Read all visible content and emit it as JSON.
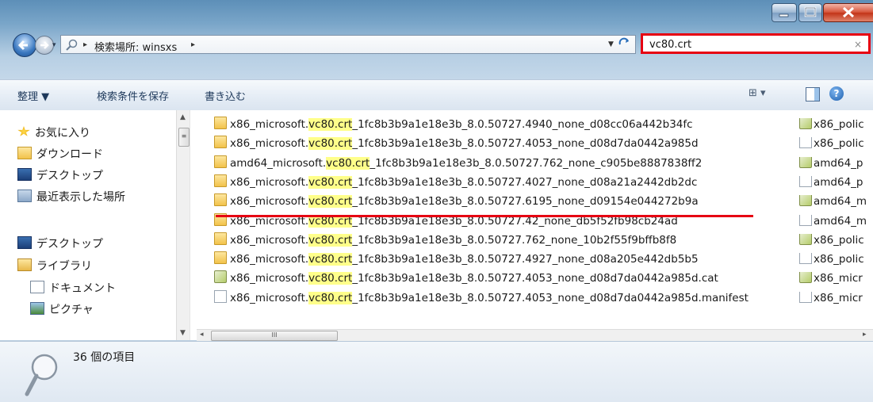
{
  "window": {
    "address": {
      "recent_dropdown": "▾",
      "separator1": "▸",
      "label": "検索場所: winsxs",
      "separator2": "▸"
    },
    "search": {
      "value": "vc80.crt",
      "clear": "×"
    }
  },
  "toolbar": {
    "organize": "整理 ▼",
    "save_search": "検索条件を保存",
    "burn": "書き込む",
    "views": "⊞ ▾",
    "help": "?"
  },
  "sidebar": {
    "items": [
      {
        "label": "お気に入り",
        "icon": "star-icon"
      },
      {
        "label": "ダウンロード",
        "icon": "download-folder-icon"
      },
      {
        "label": "デスクトップ",
        "icon": "desktop-icon"
      },
      {
        "label": "最近表示した場所",
        "icon": "recent-places-icon"
      },
      {
        "label": "デスクトップ",
        "icon": "desktop-icon"
      },
      {
        "label": "ライブラリ",
        "icon": "library-icon"
      },
      {
        "label": "ドキュメント",
        "icon": "documents-icon"
      },
      {
        "label": "ピクチャ",
        "icon": "pictures-icon"
      }
    ]
  },
  "files": [
    {
      "prefix": "x86_microsoft.",
      "match": "vc80.crt",
      "suffix": "_1fc8b3b9a1e18e3b_8.0.50727.4940_none_d08cc06a442b34fc",
      "type": "folder"
    },
    {
      "prefix": "x86_microsoft.",
      "match": "vc80.crt",
      "suffix": "_1fc8b3b9a1e18e3b_8.0.50727.4053_none_d08d7da0442a985d",
      "type": "folder"
    },
    {
      "prefix": "amd64_microsoft.",
      "match": "vc80.crt",
      "suffix": "_1fc8b3b9a1e18e3b_8.0.50727.762_none_c905be8887838ff2",
      "type": "folder"
    },
    {
      "prefix": "x86_microsoft.",
      "match": "vc80.crt",
      "suffix": "_1fc8b3b9a1e18e3b_8.0.50727.4027_none_d08a21a2442db2dc",
      "type": "folder"
    },
    {
      "prefix": "x86_microsoft.",
      "match": "vc80.crt",
      "suffix": "_1fc8b3b9a1e18e3b_8.0.50727.6195_none_d09154e044272b9a",
      "type": "folder"
    },
    {
      "prefix": "x86_microsoft.",
      "match": "vc80.crt",
      "suffix": "_1fc8b3b9a1e18e3b_8.0.50727.42_none_db5f52fb98cb24ad",
      "type": "folder"
    },
    {
      "prefix": "x86_microsoft.",
      "match": "vc80.crt",
      "suffix": "_1fc8b3b9a1e18e3b_8.0.50727.762_none_10b2f55f9bffb8f8",
      "type": "folder"
    },
    {
      "prefix": "x86_microsoft.",
      "match": "vc80.crt",
      "suffix": "_1fc8b3b9a1e18e3b_8.0.50727.4927_none_d08a205e442db5b5",
      "type": "folder"
    },
    {
      "prefix": "x86_microsoft.",
      "match": "vc80.crt",
      "suffix": "_1fc8b3b9a1e18e3b_8.0.50727.4053_none_d08d7da0442a985d.cat",
      "type": "catalog"
    },
    {
      "prefix": "x86_microsoft.",
      "match": "vc80.crt",
      "suffix": "_1fc8b3b9a1e18e3b_8.0.50727.4053_none_d08d7da0442a985d.manifest",
      "type": "manifest"
    }
  ],
  "files_col2": [
    {
      "label": "x86_polic",
      "type": "catalog"
    },
    {
      "label": "x86_polic",
      "type": "manifest"
    },
    {
      "label": "amd64_p",
      "type": "catalog"
    },
    {
      "label": "amd64_p",
      "type": "manifest"
    },
    {
      "label": "amd64_m",
      "type": "catalog"
    },
    {
      "label": "amd64_m",
      "type": "manifest"
    },
    {
      "label": "x86_polic",
      "type": "catalog"
    },
    {
      "label": "x86_polic",
      "type": "manifest"
    },
    {
      "label": "x86_micr",
      "type": "catalog"
    },
    {
      "label": "x86_micr",
      "type": "manifest"
    }
  ],
  "scrollbars": {
    "h_thumb_grip": "III",
    "v_thumb_grip": "≡",
    "arrow_up": "▲",
    "arrow_down": "▼",
    "arrow_left": "◂",
    "arrow_right": "▸"
  },
  "status": {
    "item_count": "36 個の項目"
  },
  "colors": {
    "highlight": "#ffff8a",
    "annotation_red": "#e60012"
  }
}
